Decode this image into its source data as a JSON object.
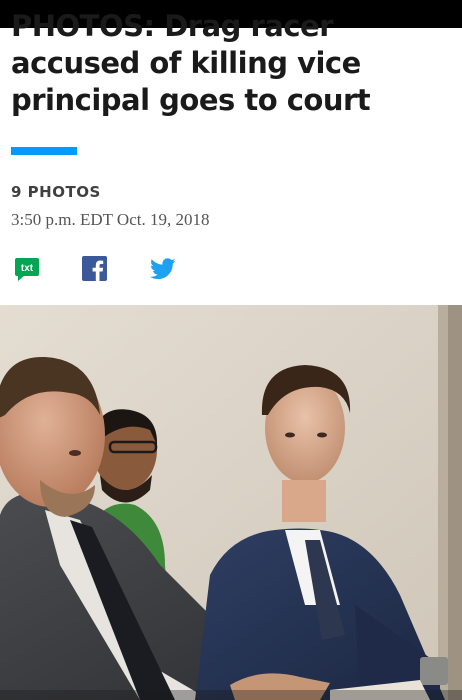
{
  "article": {
    "headline": "PHOTOS: Drag racer accused of killing vice principal goes to court",
    "photo_count": "9 PHOTOS",
    "timestamp": "3:50 p.m. EDT Oct. 19, 2018",
    "accent_color": "#009bff"
  },
  "share": {
    "text_label": "txt",
    "text_icon": "sms-share-icon",
    "facebook_icon": "facebook-icon",
    "twitter_icon": "twitter-icon",
    "text_color": "#00a651",
    "facebook_color": "#3b5998",
    "twitter_color": "#1da1f2"
  },
  "gallery": {
    "photo_icon": "courtroom-photo"
  }
}
